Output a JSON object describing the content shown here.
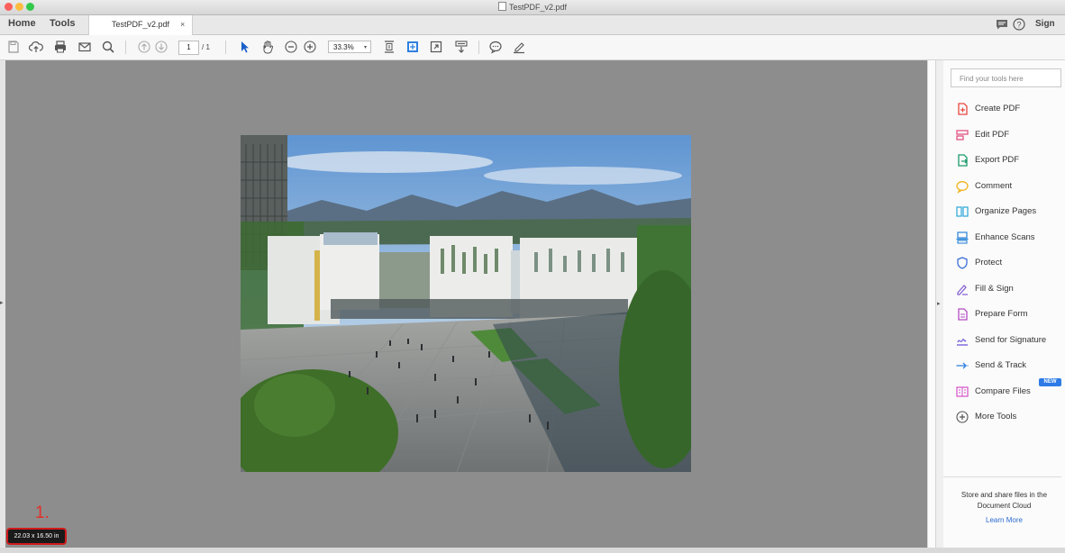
{
  "window": {
    "title": "TestPDF_v2.pdf"
  },
  "nav": {
    "home": "Home",
    "tools": "Tools",
    "tab_name": "TestPDF_v2.pdf",
    "tab_close": "×",
    "sign_in": "Sign In"
  },
  "toolbar": {
    "page_current": "1",
    "page_total": "/ 1",
    "zoom": "33.3%",
    "zoom_caret": "▾"
  },
  "document": {
    "page_size": "22.03 x 16.50 in"
  },
  "annotation": {
    "marker": "1."
  },
  "tools_panel": {
    "search_placeholder": "Find your tools here",
    "items": [
      {
        "label": "Create PDF",
        "icon": "create-pdf-icon",
        "color": "#e8473f"
      },
      {
        "label": "Edit PDF",
        "icon": "edit-pdf-icon",
        "color": "#e0457b"
      },
      {
        "label": "Export PDF",
        "icon": "export-pdf-icon",
        "color": "#1b9b6b"
      },
      {
        "label": "Comment",
        "icon": "comment-icon",
        "color": "#f2b31b"
      },
      {
        "label": "Organize Pages",
        "icon": "organize-pages-icon",
        "color": "#2aa6d8"
      },
      {
        "label": "Enhance Scans",
        "icon": "enhance-scans-icon",
        "color": "#2a84d8"
      },
      {
        "label": "Protect",
        "icon": "protect-icon",
        "color": "#3c6fd4"
      },
      {
        "label": "Fill & Sign",
        "icon": "fill-sign-icon",
        "color": "#7e5bd0"
      },
      {
        "label": "Prepare Form",
        "icon": "prepare-form-icon",
        "color": "#b64bc4"
      },
      {
        "label": "Send for Signature",
        "icon": "send-signature-icon",
        "color": "#6f57d8"
      },
      {
        "label": "Send & Track",
        "icon": "send-track-icon",
        "color": "#2f7fe0"
      },
      {
        "label": "Compare Files",
        "icon": "compare-files-icon",
        "color": "#d64fc8"
      },
      {
        "label": "More Tools",
        "icon": "more-tools-icon",
        "color": "#555555"
      }
    ],
    "new_badge": "NEW",
    "cloud_line1": "Store and share files in the",
    "cloud_line2": "Document Cloud",
    "learn_more": "Learn More"
  }
}
